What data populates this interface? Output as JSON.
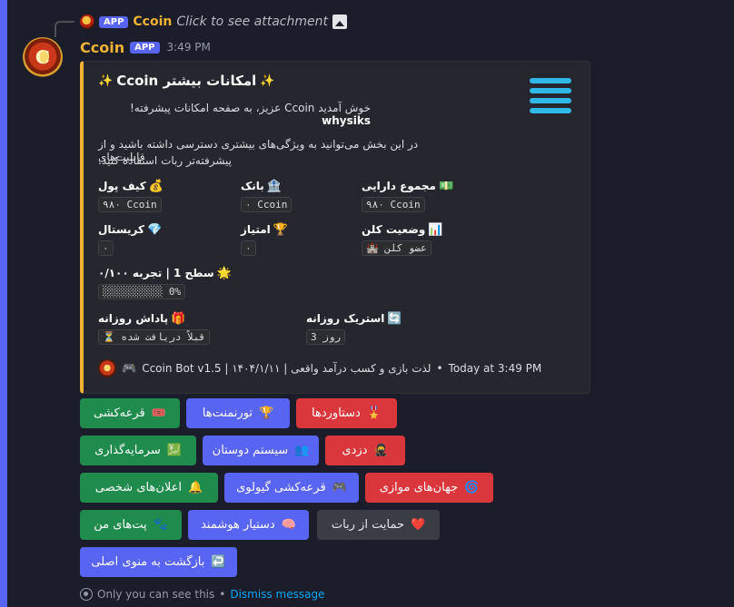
{
  "reply": {
    "app_badge": "APP",
    "author": "Ccoin",
    "text": "Click to see attachment"
  },
  "message": {
    "author": "Ccoin",
    "app_badge": "APP",
    "time": "3:49 PM",
    "avatar_letter": "C"
  },
  "embed": {
    "accent_color": "#f0b232",
    "title": "امکانات بیشتر Ccoin",
    "title_emoji": "✨",
    "line1_user": "whysiks",
    "line1_text": "خوش آمدید Ccoin عزیز، به صفحه امکانات پیشرفته!",
    "line2": "در این بخش می‌توانید به ویژگی‌های بیشتری دسترسی داشته باشید و از قابلیت‌های",
    "line3": "پیشرفته‌تر ربات استفاده کنید.",
    "fields": {
      "wallet": {
        "emoji": "💰",
        "name": "کیف پول",
        "value": "۹۸۰ Ccoin"
      },
      "bank": {
        "emoji": "🏦",
        "name": "بانک",
        "value": "۰ Ccoin"
      },
      "total": {
        "emoji": "💵",
        "name": "مجموع دارایی",
        "value": "۹۸۰ Ccoin"
      },
      "crystal": {
        "emoji": "💎",
        "name": "کریستال",
        "value": "۰"
      },
      "score": {
        "emoji": "🏆",
        "name": "امتیاز",
        "value": "۰"
      },
      "clan": {
        "emoji": "📊",
        "name": "وضعیت کلن",
        "value": "🏰 عضو کلن"
      },
      "level": {
        "emoji": "🌟",
        "name": "سطح 1 | تجربه ۰/۱۰۰",
        "value": "░░░░░░░░░░ 0%"
      },
      "daily": {
        "emoji": "🎁",
        "name": "پاداش روزانه",
        "value": "⏳ قبلاً دریافت شده"
      },
      "streak": {
        "emoji": "🔄",
        "name": "استریک روزانه",
        "value": "3 روز"
      }
    },
    "footer": {
      "emoji": "🎮",
      "text": "Ccoin Bot v1.5 | ۱۴۰۴/۱/۱۱ | لذت بازی و کسب درآمد واقعی",
      "separator": "•",
      "time": "Today at 3:49 PM"
    }
  },
  "buttons": {
    "row1": [
      {
        "label": "قرعه‌کشی",
        "emoji": "🎟️",
        "style": "green"
      },
      {
        "label": "تورنمنت‌ها",
        "emoji": "🏆",
        "style": "blurple"
      },
      {
        "label": "دستاوردها",
        "emoji": "🎖️",
        "style": "red"
      }
    ],
    "row2": [
      {
        "label": "سرمایه‌گذاری",
        "emoji": "💹",
        "style": "green"
      },
      {
        "label": "سیستم دوستان",
        "emoji": "👥",
        "style": "blurple"
      },
      {
        "label": "دزدی",
        "emoji": "🥷",
        "style": "red"
      }
    ],
    "row3": [
      {
        "label": "اعلان‌های شخصی",
        "emoji": "🔔",
        "style": "green"
      },
      {
        "label": "قرعه‌کشی گیولوی",
        "emoji": "🎮",
        "style": "blurple"
      },
      {
        "label": "جهان‌های موازی",
        "emoji": "🌀",
        "style": "red"
      }
    ],
    "row4": [
      {
        "label": "پت‌های من",
        "emoji": "🐾",
        "style": "green"
      },
      {
        "label": "دستیار هوشمند",
        "emoji": "🧠",
        "style": "blurple"
      },
      {
        "label": "حمایت از ربات",
        "emoji": "❤️",
        "style": "grey"
      }
    ],
    "row5": [
      {
        "label": "بازگشت به منوی اصلی",
        "emoji": "↩️",
        "style": "blurple"
      }
    ]
  },
  "ephemeral": {
    "text": "Only you can see this",
    "separator": "•",
    "dismiss": "Dismiss message"
  }
}
